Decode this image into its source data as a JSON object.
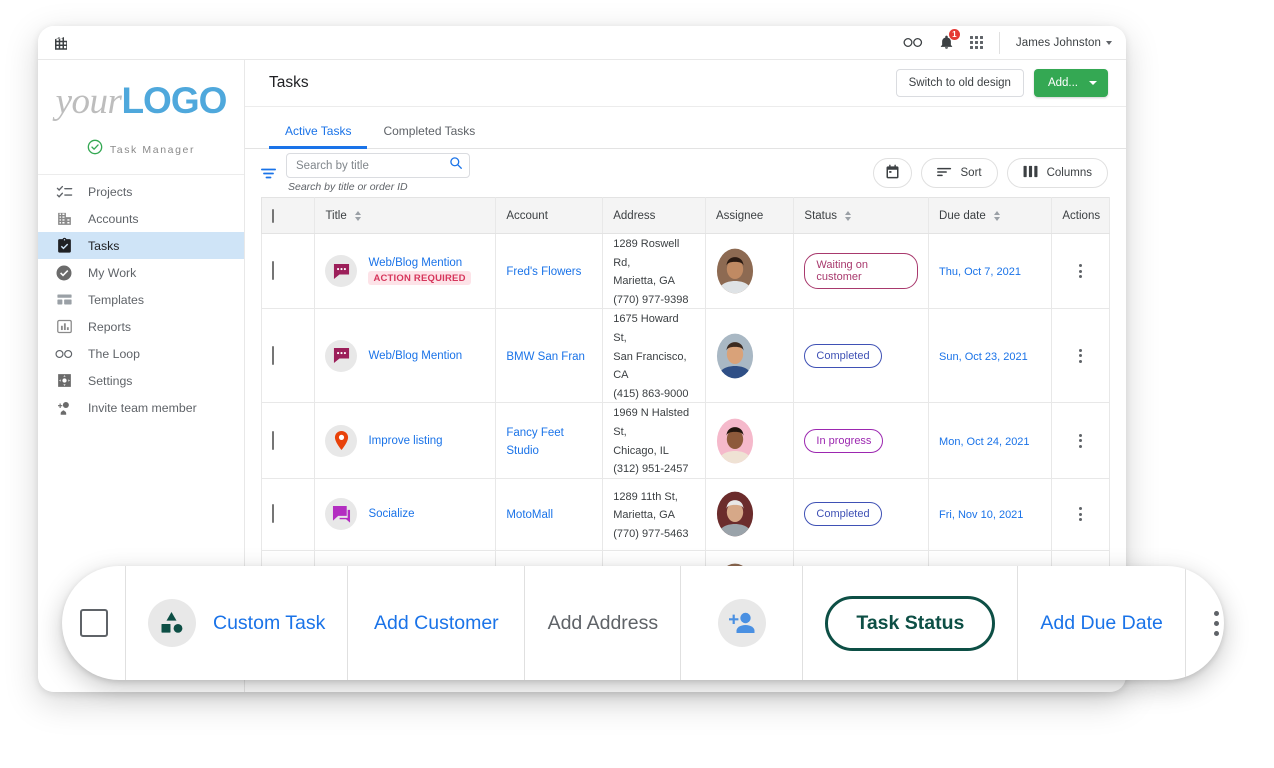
{
  "topbar": {
    "building_icon": "building-icon",
    "loop_icon": "infinity-icon",
    "notifications_count": "1",
    "apps_icon": "apps-grid-icon",
    "user_name": "James Johnston"
  },
  "sidebar": {
    "logo_prefix": "your",
    "logo_suffix": "LOGO",
    "product_name": "Task Manager",
    "items": [
      {
        "label": "Projects",
        "icon": "checklist-icon",
        "active": false
      },
      {
        "label": "Accounts",
        "icon": "building-icon",
        "active": false
      },
      {
        "label": "Tasks",
        "icon": "clipboard-check-icon",
        "active": true
      },
      {
        "label": "My Work",
        "icon": "check-circle-icon",
        "active": false
      },
      {
        "label": "Templates",
        "icon": "layout-icon",
        "active": false
      },
      {
        "label": "Reports",
        "icon": "bar-chart-icon",
        "active": false
      },
      {
        "label": "The Loop",
        "icon": "infinity-icon",
        "active": false
      },
      {
        "label": "Settings",
        "icon": "gear-icon",
        "active": false
      },
      {
        "label": "Invite team member",
        "icon": "person-add-icon",
        "active": false
      }
    ]
  },
  "header": {
    "title": "Tasks",
    "switch_design_label": "Switch to old design",
    "add_label": "Add..."
  },
  "tabs": [
    {
      "label": "Active Tasks",
      "active": true
    },
    {
      "label": "Completed Tasks",
      "active": false
    }
  ],
  "toolbar": {
    "filter_icon": "filter-icon",
    "search_value": "",
    "search_placeholder": "Search by title",
    "search_icon": "search-icon",
    "search_hint": "Search by title or order ID",
    "calendar_icon": "calendar-icon",
    "sort_label": "Sort",
    "sort_icon": "sort-icon",
    "columns_label": "Columns",
    "columns_icon": "columns-icon"
  },
  "table": {
    "columns": [
      {
        "label": "",
        "name": "select"
      },
      {
        "label": "Title",
        "name": "title",
        "sortable": true
      },
      {
        "label": "Account",
        "name": "account",
        "sortable": false
      },
      {
        "label": "Address",
        "name": "address",
        "sortable": false
      },
      {
        "label": "Assignee",
        "name": "assignee",
        "sortable": false
      },
      {
        "label": "Status",
        "name": "status",
        "sortable": true
      },
      {
        "label": "Due date",
        "name": "due_date",
        "sortable": true
      },
      {
        "label": "Actions",
        "name": "actions",
        "sortable": false
      }
    ],
    "rows": [
      {
        "title": "Web/Blog Mention",
        "tag": "ACTION REQUIRED",
        "icon": "chat-bubble-icon",
        "icon_color": "#9c1f5a",
        "account": "Fred's Flowers",
        "address": "1289 Roswell Rd,\nMarietta, GA\n(770) 977-9398",
        "assignee_avatar": "avatar-man-curly-hair",
        "status": "Waiting on customer",
        "status_color": "#a8396d",
        "due_date": "Thu, Oct 7, 2021"
      },
      {
        "title": "Web/Blog Mention",
        "tag": "",
        "icon": "chat-bubble-icon",
        "icon_color": "#9c1f5a",
        "account": "BMW San Fran",
        "address": "1675 Howard St,\nSan Francisco, CA\n(415) 863-9000",
        "assignee_avatar": "avatar-woman-camera",
        "status": "Completed",
        "status_color": "#3f51b5",
        "due_date": "Sun, Oct 23, 2021"
      },
      {
        "title": "Improve listing",
        "tag": "",
        "icon": "map-pin-icon",
        "icon_color": "#e8420a",
        "account": "Fancy Feet Studio",
        "address": "1969 N Halsted St,\nChicago, IL\n(312) 951-2457",
        "assignee_avatar": "avatar-woman-pink-bg",
        "status": "In progress",
        "status_color": "#9c27b0",
        "due_date": "Mon, Oct 24, 2021"
      },
      {
        "title": "Socialize",
        "tag": "",
        "icon": "chat-bubble-icon",
        "icon_color": "#b32ec1",
        "account": "MotoMall",
        "address": "1289 11th St,\nMarietta, GA\n(770) 977-5463",
        "assignee_avatar": "avatar-older-woman-glasses",
        "status": "Completed",
        "status_color": "#3f51b5",
        "due_date": "Fri, Nov 10, 2021"
      }
    ]
  },
  "overlay": {
    "checkbox": "select-all-checkbox",
    "custom_task_icon": "shapes-icon",
    "custom_task_label": "Custom Task",
    "add_customer_label": "Add Customer",
    "add_address_label": "Add Address",
    "assignee_icon": "person-add-icon",
    "task_status_label": "Task Status",
    "add_due_date_label": "Add Due Date",
    "more_icon": "kebab-menu-icon",
    "accent_color": "#0d4f45",
    "link_color": "#1a73e8"
  }
}
